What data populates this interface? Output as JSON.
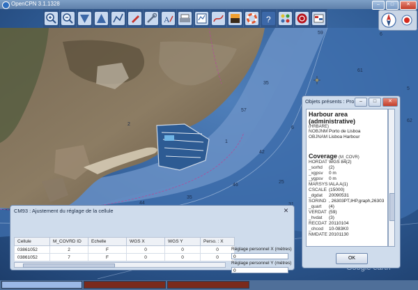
{
  "window": {
    "title": "OpenCPN 3.1.1328",
    "minimize": "–",
    "maximize": "□",
    "close": "✕"
  },
  "toolbar": {
    "tools": [
      "zoom-in",
      "zoom-out",
      "scale-in",
      "scale-out",
      "route",
      "ship-track",
      "settings",
      "text-tool",
      "print",
      "route-manager",
      "track",
      "color-scheme",
      "ais",
      "help",
      "plugins",
      "mob",
      "info"
    ]
  },
  "map": {
    "soundings": [
      {
        "t": "59",
        "x": 0,
        "y": 0
      },
      {
        "t": "6",
        "x": 0,
        "y": 0
      },
      {
        "t": "61",
        "x": 0,
        "y": 0
      },
      {
        "t": "57",
        "x": 0,
        "y": 0
      },
      {
        "t": "35",
        "x": 0,
        "y": 0
      },
      {
        "t": "62",
        "x": 0,
        "y": 0
      },
      {
        "t": "2",
        "x": 0,
        "y": 0
      },
      {
        "t": "25",
        "x": 0,
        "y": 0
      },
      {
        "t": "46",
        "x": 0,
        "y": 0
      },
      {
        "t": "35",
        "x": 0,
        "y": 0
      },
      {
        "t": "44",
        "x": 0,
        "y": 0
      },
      {
        "t": "31",
        "x": 0,
        "y": 0
      },
      {
        "t": "42",
        "x": 0,
        "y": 0
      },
      {
        "t": "6",
        "x": 0,
        "y": 0
      },
      {
        "t": "1",
        "x": 0,
        "y": 0
      },
      {
        "t": "5",
        "x": 0,
        "y": 0
      }
    ],
    "watermark": "Google earth"
  },
  "objects_panel": {
    "title": "Objets présents : Pro...",
    "feature1": {
      "name": "Harbour area (administrative)",
      "code": "(HRBARE)",
      "attrs": [
        {
          "k": "NOBJNM",
          "v": "Porto de Lisboa"
        },
        {
          "k": "OBJNAM",
          "v": "Lisboa Harbour"
        }
      ]
    },
    "feature2": {
      "name": "Coverage",
      "code": "(M_COVR)",
      "attrs": [
        {
          "k": "HORDAT",
          "v": "WGS 84(2)"
        },
        {
          "k": "_sorhd",
          "v": "(2)"
        },
        {
          "k": "_xgpsv",
          "v": "0 m"
        },
        {
          "k": "_ygpsv",
          "v": "0 m"
        },
        {
          "k": "MARSYS",
          "v": "IALA A(1)"
        },
        {
          "k": "CSCALE",
          "v": "(15000)"
        },
        {
          "k": "_dgdat",
          "v": "20090531"
        },
        {
          "k": "SORIND",
          "v": ", 26303PT,IHP,graph,26303"
        },
        {
          "k": "_quart",
          "v": "(4)"
        },
        {
          "k": "VERDAT",
          "v": "(59)"
        },
        {
          "k": "_hvdat",
          "v": "(3)"
        },
        {
          "k": "RECDAT",
          "v": "20110104"
        },
        {
          "k": "_chcod",
          "v": "10-083K0"
        },
        {
          "k": "NMDATE",
          "v": "20101130"
        }
      ]
    },
    "ok_label": "OK"
  },
  "cm93_panel": {
    "title": "CM93 : Ajustement du réglage de la cellule",
    "columns": [
      "Cellule",
      "M_COVRD ID",
      "Echelle",
      "WGS X",
      "WGS Y",
      "Perso. : X"
    ],
    "rows": [
      [
        "03861052",
        "2",
        "F",
        "0",
        "0",
        "0"
      ],
      [
        "03861052",
        "7",
        "F",
        "0",
        "0",
        "0"
      ]
    ],
    "adjust_x_label": "Réglage personnel X (mètres)",
    "adjust_x_value": "0",
    "adjust_y_label": "Réglage personnel Y (mètres)",
    "adjust_y_value": "0"
  },
  "colors": {
    "sea_dark": "#1c3e6e",
    "sea_mid": "#3a6aa6",
    "sea_light": "#7fa3cf",
    "land": "#6f5e4a",
    "panel": "#cfdcec",
    "status_red": "#7a2a1c"
  }
}
